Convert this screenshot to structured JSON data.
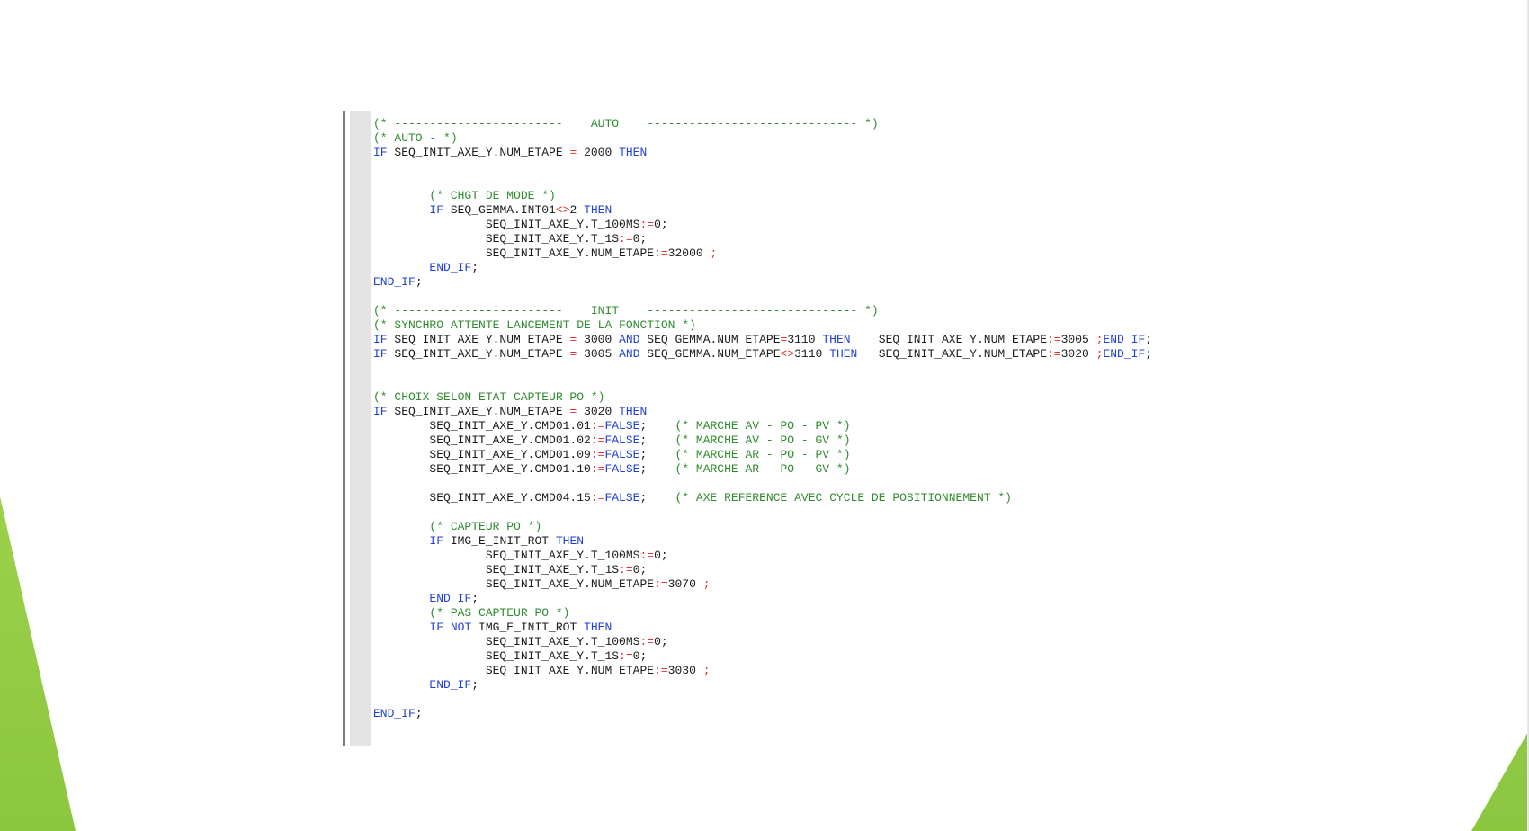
{
  "colors": {
    "comment": "#2e8b2e",
    "keyword": "#1f3fd6",
    "operator": "#e03030",
    "text": "#1a1a1a",
    "margin": "#e4e4e4",
    "accent_green": "#8cc63f"
  },
  "code_lines": [
    [
      {
        "t": "c",
        "v": "(* ------------------------    AUTO    ------------------------------ *)"
      }
    ],
    [
      {
        "t": "c",
        "v": "(* AUTO - *)"
      }
    ],
    [
      {
        "t": "k",
        "v": "IF"
      },
      {
        "t": "n",
        "v": " SEQ_INIT_AXE_Y.NUM_ETAPE "
      },
      {
        "t": "o",
        "v": "="
      },
      {
        "t": "n",
        "v": " 2000 "
      },
      {
        "t": "k",
        "v": "THEN"
      }
    ],
    [],
    [],
    [
      {
        "t": "n",
        "v": "        "
      },
      {
        "t": "c",
        "v": "(* CHGT DE MODE *)"
      }
    ],
    [
      {
        "t": "n",
        "v": "        "
      },
      {
        "t": "k",
        "v": "IF"
      },
      {
        "t": "n",
        "v": " SEQ_GEMMA.INT01"
      },
      {
        "t": "o",
        "v": "<>"
      },
      {
        "t": "n",
        "v": "2 "
      },
      {
        "t": "k",
        "v": "THEN"
      }
    ],
    [
      {
        "t": "n",
        "v": "                SEQ_INIT_AXE_Y.T_100MS"
      },
      {
        "t": "o",
        "v": ":="
      },
      {
        "t": "n",
        "v": "0;"
      }
    ],
    [
      {
        "t": "n",
        "v": "                SEQ_INIT_AXE_Y.T_1S"
      },
      {
        "t": "o",
        "v": ":="
      },
      {
        "t": "n",
        "v": "0;"
      }
    ],
    [
      {
        "t": "n",
        "v": "                SEQ_INIT_AXE_Y.NUM_ETAPE"
      },
      {
        "t": "o",
        "v": ":="
      },
      {
        "t": "n",
        "v": "32000 "
      },
      {
        "t": "o",
        "v": ";"
      }
    ],
    [
      {
        "t": "n",
        "v": "        "
      },
      {
        "t": "k",
        "v": "END_IF"
      },
      {
        "t": "n",
        "v": ";"
      }
    ],
    [
      {
        "t": "k",
        "v": "END_IF"
      },
      {
        "t": "n",
        "v": ";"
      }
    ],
    [],
    [
      {
        "t": "c",
        "v": "(* ------------------------    INIT    ------------------------------ *)"
      }
    ],
    [
      {
        "t": "c",
        "v": "(* SYNCHRO ATTENTE LANCEMENT DE LA FONCTION *)"
      }
    ],
    [
      {
        "t": "k",
        "v": "IF"
      },
      {
        "t": "n",
        "v": " SEQ_INIT_AXE_Y.NUM_ETAPE "
      },
      {
        "t": "o",
        "v": "="
      },
      {
        "t": "n",
        "v": " 3000 "
      },
      {
        "t": "k",
        "v": "AND"
      },
      {
        "t": "n",
        "v": " SEQ_GEMMA.NUM_ETAPE"
      },
      {
        "t": "o",
        "v": "="
      },
      {
        "t": "n",
        "v": "3110 "
      },
      {
        "t": "k",
        "v": "THEN"
      },
      {
        "t": "n",
        "v": "    SEQ_INIT_AXE_Y.NUM_ETAPE"
      },
      {
        "t": "o",
        "v": ":="
      },
      {
        "t": "n",
        "v": "3005 "
      },
      {
        "t": "o",
        "v": ";"
      },
      {
        "t": "k",
        "v": "END_IF"
      },
      {
        "t": "n",
        "v": ";"
      }
    ],
    [
      {
        "t": "k",
        "v": "IF"
      },
      {
        "t": "n",
        "v": " SEQ_INIT_AXE_Y.NUM_ETAPE "
      },
      {
        "t": "o",
        "v": "="
      },
      {
        "t": "n",
        "v": " 3005 "
      },
      {
        "t": "k",
        "v": "AND"
      },
      {
        "t": "n",
        "v": " SEQ_GEMMA.NUM_ETAPE"
      },
      {
        "t": "o",
        "v": "<>"
      },
      {
        "t": "n",
        "v": "3110 "
      },
      {
        "t": "k",
        "v": "THEN"
      },
      {
        "t": "n",
        "v": "   SEQ_INIT_AXE_Y.NUM_ETAPE"
      },
      {
        "t": "o",
        "v": ":="
      },
      {
        "t": "n",
        "v": "3020 "
      },
      {
        "t": "o",
        "v": ";"
      },
      {
        "t": "k",
        "v": "END_IF"
      },
      {
        "t": "n",
        "v": ";"
      }
    ],
    [],
    [],
    [
      {
        "t": "c",
        "v": "(* CHOIX SELON ETAT CAPTEUR PO *)"
      }
    ],
    [
      {
        "t": "k",
        "v": "IF"
      },
      {
        "t": "n",
        "v": " SEQ_INIT_AXE_Y.NUM_ETAPE "
      },
      {
        "t": "o",
        "v": "="
      },
      {
        "t": "n",
        "v": " 3020 "
      },
      {
        "t": "k",
        "v": "THEN"
      }
    ],
    [
      {
        "t": "n",
        "v": "        SEQ_INIT_AXE_Y.CMD01.01"
      },
      {
        "t": "o",
        "v": ":="
      },
      {
        "t": "k",
        "v": "FALSE"
      },
      {
        "t": "n",
        "v": ";    "
      },
      {
        "t": "c",
        "v": "(* MARCHE AV - PO - PV *)"
      }
    ],
    [
      {
        "t": "n",
        "v": "        SEQ_INIT_AXE_Y.CMD01.02"
      },
      {
        "t": "o",
        "v": ":="
      },
      {
        "t": "k",
        "v": "FALSE"
      },
      {
        "t": "n",
        "v": ";    "
      },
      {
        "t": "c",
        "v": "(* MARCHE AV - PO - GV *)"
      }
    ],
    [
      {
        "t": "n",
        "v": "        SEQ_INIT_AXE_Y.CMD01.09"
      },
      {
        "t": "o",
        "v": ":="
      },
      {
        "t": "k",
        "v": "FALSE"
      },
      {
        "t": "n",
        "v": ";    "
      },
      {
        "t": "c",
        "v": "(* MARCHE AR - PO - PV *)"
      }
    ],
    [
      {
        "t": "n",
        "v": "        SEQ_INIT_AXE_Y.CMD01.10"
      },
      {
        "t": "o",
        "v": ":="
      },
      {
        "t": "k",
        "v": "FALSE"
      },
      {
        "t": "n",
        "v": ";    "
      },
      {
        "t": "c",
        "v": "(* MARCHE AR - PO - GV *)"
      }
    ],
    [],
    [
      {
        "t": "n",
        "v": "        SEQ_INIT_AXE_Y.CMD04.15"
      },
      {
        "t": "o",
        "v": ":="
      },
      {
        "t": "k",
        "v": "FALSE"
      },
      {
        "t": "n",
        "v": ";    "
      },
      {
        "t": "c",
        "v": "(* AXE REFERENCE AVEC CYCLE DE POSITIONNEMENT *)"
      }
    ],
    [],
    [
      {
        "t": "n",
        "v": "        "
      },
      {
        "t": "c",
        "v": "(* CAPTEUR PO *)"
      }
    ],
    [
      {
        "t": "n",
        "v": "        "
      },
      {
        "t": "k",
        "v": "IF"
      },
      {
        "t": "n",
        "v": " IMG_E_INIT_ROT "
      },
      {
        "t": "k",
        "v": "THEN"
      }
    ],
    [
      {
        "t": "n",
        "v": "                SEQ_INIT_AXE_Y.T_100MS"
      },
      {
        "t": "o",
        "v": ":="
      },
      {
        "t": "n",
        "v": "0;"
      }
    ],
    [
      {
        "t": "n",
        "v": "                SEQ_INIT_AXE_Y.T_1S"
      },
      {
        "t": "o",
        "v": ":="
      },
      {
        "t": "n",
        "v": "0;"
      }
    ],
    [
      {
        "t": "n",
        "v": "                SEQ_INIT_AXE_Y.NUM_ETAPE"
      },
      {
        "t": "o",
        "v": ":="
      },
      {
        "t": "n",
        "v": "3070 "
      },
      {
        "t": "o",
        "v": ";"
      }
    ],
    [
      {
        "t": "n",
        "v": "        "
      },
      {
        "t": "k",
        "v": "END_IF"
      },
      {
        "t": "n",
        "v": ";"
      }
    ],
    [
      {
        "t": "n",
        "v": "        "
      },
      {
        "t": "c",
        "v": "(* PAS CAPTEUR PO *)"
      }
    ],
    [
      {
        "t": "n",
        "v": "        "
      },
      {
        "t": "k",
        "v": "IF NOT"
      },
      {
        "t": "n",
        "v": " IMG_E_INIT_ROT "
      },
      {
        "t": "k",
        "v": "THEN"
      }
    ],
    [
      {
        "t": "n",
        "v": "                SEQ_INIT_AXE_Y.T_100MS"
      },
      {
        "t": "o",
        "v": ":="
      },
      {
        "t": "n",
        "v": "0;"
      }
    ],
    [
      {
        "t": "n",
        "v": "                SEQ_INIT_AXE_Y.T_1S"
      },
      {
        "t": "o",
        "v": ":="
      },
      {
        "t": "n",
        "v": "0;"
      }
    ],
    [
      {
        "t": "n",
        "v": "                SEQ_INIT_AXE_Y.NUM_ETAPE"
      },
      {
        "t": "o",
        "v": ":="
      },
      {
        "t": "n",
        "v": "3030 "
      },
      {
        "t": "o",
        "v": ";"
      }
    ],
    [
      {
        "t": "n",
        "v": "        "
      },
      {
        "t": "k",
        "v": "END_IF"
      },
      {
        "t": "n",
        "v": ";"
      }
    ],
    [],
    [
      {
        "t": "k",
        "v": "END_IF"
      },
      {
        "t": "n",
        "v": ";"
      }
    ]
  ]
}
